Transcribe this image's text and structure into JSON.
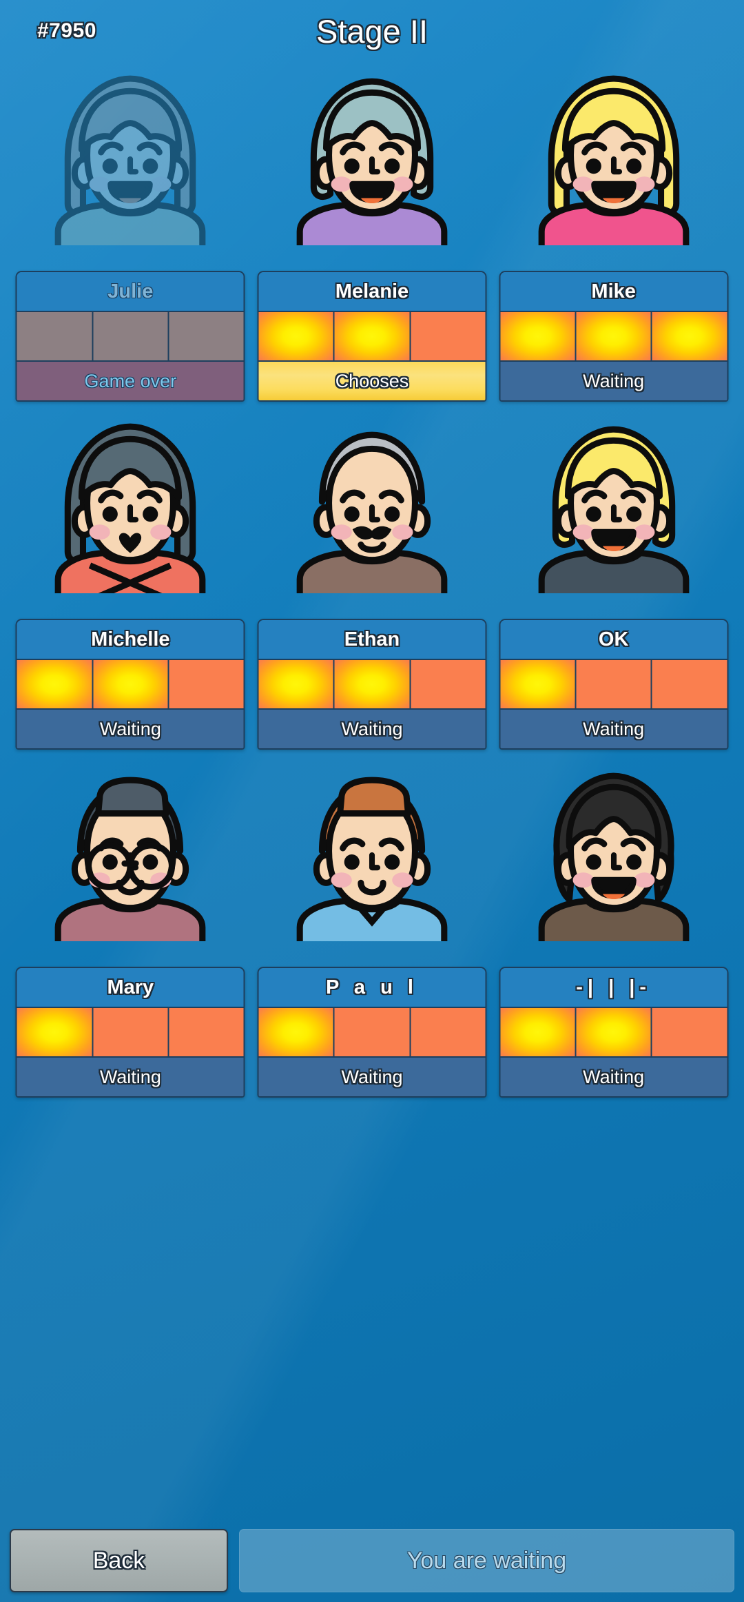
{
  "header": {
    "room_id": "#7950",
    "title": "Stage II"
  },
  "colors": {
    "background_blue": "#1380bf",
    "card_name_bar": "#2581c0",
    "life_on": "#ffee00",
    "life_off": "#fa7f4f",
    "life_dead": "#8d8083",
    "status_waiting": "#3c6a9b",
    "status_chooses": "#fbe27e",
    "status_gameover": "#7f5f7c",
    "back_button": "#a8b1b1"
  },
  "players": [
    {
      "name": "Julie",
      "status": "Game over",
      "status_kind": "gameover",
      "lives_total": 3,
      "lives_on": 0,
      "eliminated": true,
      "avatar": "julie-avatar"
    },
    {
      "name": "Melanie",
      "status": "Chooses",
      "status_kind": "chooses",
      "lives_total": 3,
      "lives_on": 2,
      "eliminated": false,
      "avatar": "melanie-avatar"
    },
    {
      "name": "Mike",
      "status": "Waiting",
      "status_kind": "waiting",
      "lives_total": 3,
      "lives_on": 3,
      "eliminated": false,
      "avatar": "mike-avatar"
    },
    {
      "name": "Michelle",
      "status": "Waiting",
      "status_kind": "waiting",
      "lives_total": 3,
      "lives_on": 2,
      "eliminated": false,
      "avatar": "michelle-avatar"
    },
    {
      "name": "Ethan",
      "status": "Waiting",
      "status_kind": "waiting",
      "lives_total": 3,
      "lives_on": 2,
      "eliminated": false,
      "avatar": "ethan-avatar"
    },
    {
      "name": "OK",
      "status": "Waiting",
      "status_kind": "waiting",
      "lives_total": 3,
      "lives_on": 1,
      "eliminated": false,
      "avatar": "ok-avatar"
    },
    {
      "name": "Mary",
      "status": "Waiting",
      "status_kind": "waiting",
      "lives_total": 3,
      "lives_on": 1,
      "eliminated": false,
      "avatar": "mary-avatar"
    },
    {
      "name": "P a u l",
      "status": "Waiting",
      "status_kind": "waiting",
      "lives_total": 3,
      "lives_on": 1,
      "eliminated": false,
      "avatar": "paul-avatar"
    },
    {
      "name": "-| | |-",
      "status": "Waiting",
      "status_kind": "waiting",
      "lives_total": 3,
      "lives_on": 2,
      "eliminated": false,
      "avatar": "anon-avatar"
    }
  ],
  "footer": {
    "back_label": "Back",
    "action_label": "You are waiting"
  }
}
